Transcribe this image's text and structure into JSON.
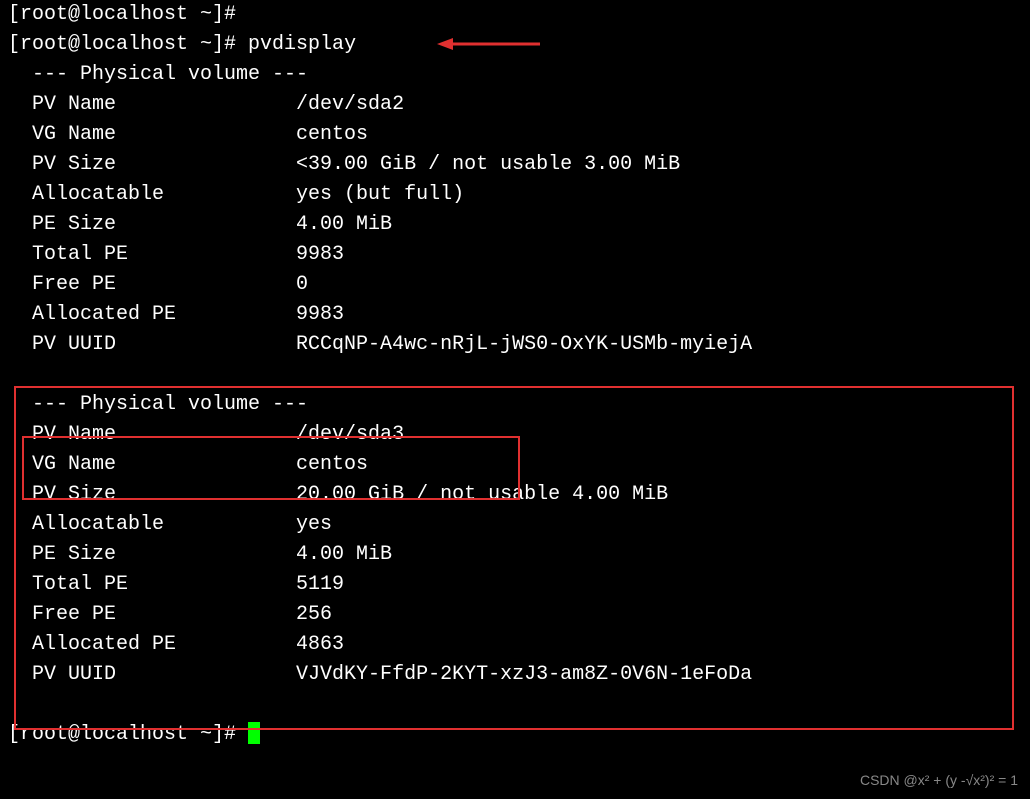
{
  "prompt_partial": "[root@localhost ~]#",
  "prompt": "[root@localhost ~]# ",
  "command": "pvdisplay",
  "section_header": "  --- Physical volume ---",
  "pv1": {
    "pv_name_label": "  PV Name               ",
    "pv_name_value": "/dev/sda2",
    "vg_name_label": "  VG Name               ",
    "vg_name_value": "centos",
    "pv_size_label": "  PV Size               ",
    "pv_size_value": "<39.00 GiB / not usable 3.00 MiB",
    "alloc_label": "  Allocatable           ",
    "alloc_value": "yes (but full)",
    "pe_size_label": "  PE Size               ",
    "pe_size_value": "4.00 MiB",
    "total_pe_label": "  Total PE              ",
    "total_pe_value": "9983",
    "free_pe_label": "  Free PE               ",
    "free_pe_value": "0",
    "alloc_pe_label": "  Allocated PE          ",
    "alloc_pe_value": "9983",
    "uuid_label": "  PV UUID               ",
    "uuid_value": "RCCqNP-A4wc-nRjL-jWS0-OxYK-USMb-myiejA"
  },
  "blank": "   ",
  "pv2": {
    "pv_name_label": "  PV Name               ",
    "pv_name_value": "/dev/sda3",
    "vg_name_label": "  VG Name               ",
    "vg_name_value": "centos",
    "pv_size_label": "  PV Size               ",
    "pv_size_value": "20.00 GiB / not usable 4.00 MiB",
    "alloc_label": "  Allocatable           ",
    "alloc_value": "yes",
    "pe_size_label": "  PE Size               ",
    "pe_size_value": "4.00 MiB",
    "total_pe_label": "  Total PE              ",
    "total_pe_value": "5119",
    "free_pe_label": "  Free PE               ",
    "free_pe_value": "256",
    "alloc_pe_label": "  Allocated PE          ",
    "alloc_pe_value": "4863",
    "uuid_label": "  PV UUID               ",
    "uuid_value": "VJVdKY-FfdP-2KYT-xzJ3-am8Z-0V6N-1eFoDa"
  },
  "watermark": "CSDN @x² + (y -√x²)² = 1"
}
